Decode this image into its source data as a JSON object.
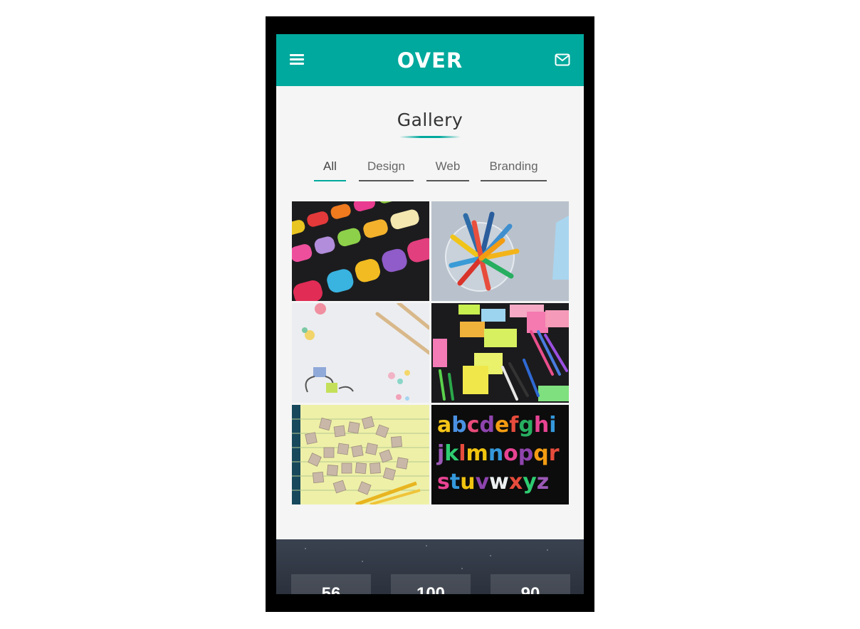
{
  "header": {
    "brand": "OVER",
    "menu_icon": "hamburger-menu-icon",
    "mail_icon": "envelope-icon",
    "accent_color": "#00a99d"
  },
  "gallery": {
    "title": "Gallery",
    "filters": [
      {
        "label": "All",
        "active": true
      },
      {
        "label": "Design",
        "active": false
      },
      {
        "label": "Web",
        "active": false
      },
      {
        "label": "Branding",
        "active": false
      }
    ],
    "images": [
      {
        "subject": "felt-letters-on-black"
      },
      {
        "subject": "colored-pencils-in-cup"
      },
      {
        "subject": "pencils-and-binder-clips"
      },
      {
        "subject": "sticky-notes-and-markers"
      },
      {
        "subject": "scrabble-tiles-back-to-school"
      },
      {
        "subject": "colorful-alphabet-letters"
      }
    ]
  },
  "stats": {
    "values": [
      "56",
      "100",
      "90"
    ]
  }
}
